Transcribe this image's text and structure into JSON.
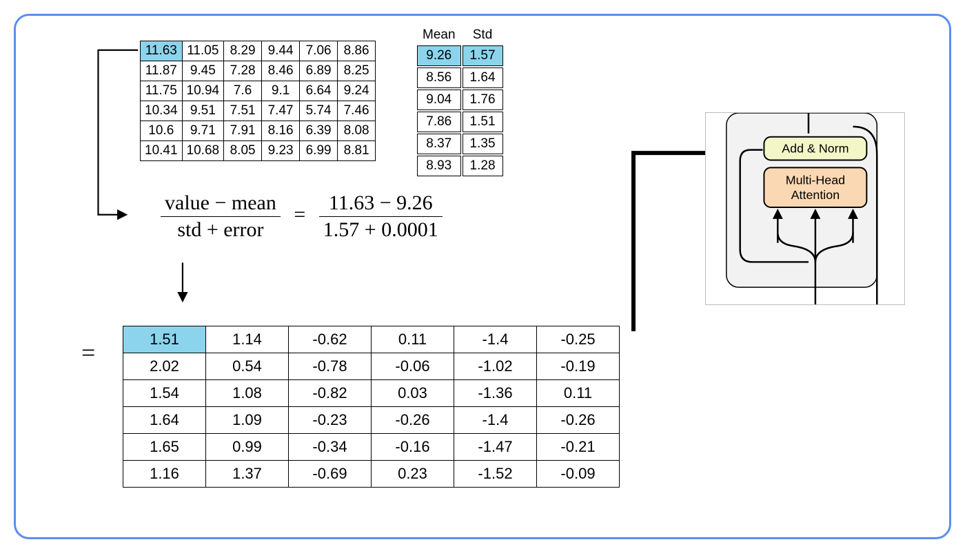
{
  "input_matrix": {
    "highlight": [
      0,
      0
    ],
    "rows": [
      [
        "11.63",
        "11.05",
        "8.29",
        "9.44",
        "7.06",
        "8.86"
      ],
      [
        "11.87",
        "9.45",
        "7.28",
        "8.46",
        "6.89",
        "8.25"
      ],
      [
        "11.75",
        "10.94",
        "7.6",
        "9.1",
        "6.64",
        "9.24"
      ],
      [
        "10.34",
        "9.51",
        "7.51",
        "7.47",
        "5.74",
        "7.46"
      ],
      [
        "10.6",
        "9.71",
        "7.91",
        "8.16",
        "6.39",
        "8.08"
      ],
      [
        "10.41",
        "10.68",
        "8.05",
        "9.23",
        "6.99",
        "8.81"
      ]
    ]
  },
  "stats": {
    "headers": [
      "Mean",
      "Std"
    ],
    "highlight_row": 0,
    "rows": [
      [
        "9.26",
        "1.57"
      ],
      [
        "8.56",
        "1.64"
      ],
      [
        "9.04",
        "1.76"
      ],
      [
        "7.86",
        "1.51"
      ],
      [
        "8.37",
        "1.35"
      ],
      [
        "8.93",
        "1.28"
      ]
    ]
  },
  "formula": {
    "num_left": "value − mean",
    "den_left": "std + error",
    "eq": "=",
    "num_right": "11.63 − 9.26",
    "den_right": "1.57 + 0.0001"
  },
  "equals_label": "=",
  "result_matrix": {
    "highlight": [
      0,
      0
    ],
    "rows": [
      [
        "1.51",
        "1.14",
        "-0.62",
        "0.11",
        "-1.4",
        "-0.25"
      ],
      [
        "2.02",
        "0.54",
        "-0.78",
        "-0.06",
        "-1.02",
        "-0.19"
      ],
      [
        "1.54",
        "1.08",
        "-0.82",
        "0.03",
        "-1.36",
        "0.11"
      ],
      [
        "1.64",
        "1.09",
        "-0.23",
        "-0.26",
        "-1.4",
        "-0.26"
      ],
      [
        "1.65",
        "0.99",
        "-0.34",
        "-0.16",
        "-1.47",
        "-0.21"
      ],
      [
        "1.16",
        "1.37",
        "-0.69",
        "0.23",
        "-1.52",
        "-0.09"
      ]
    ]
  },
  "architecture": {
    "addnorm_label": "Add & Norm",
    "mha_label_1": "Multi-Head",
    "mha_label_2": "Attention"
  }
}
